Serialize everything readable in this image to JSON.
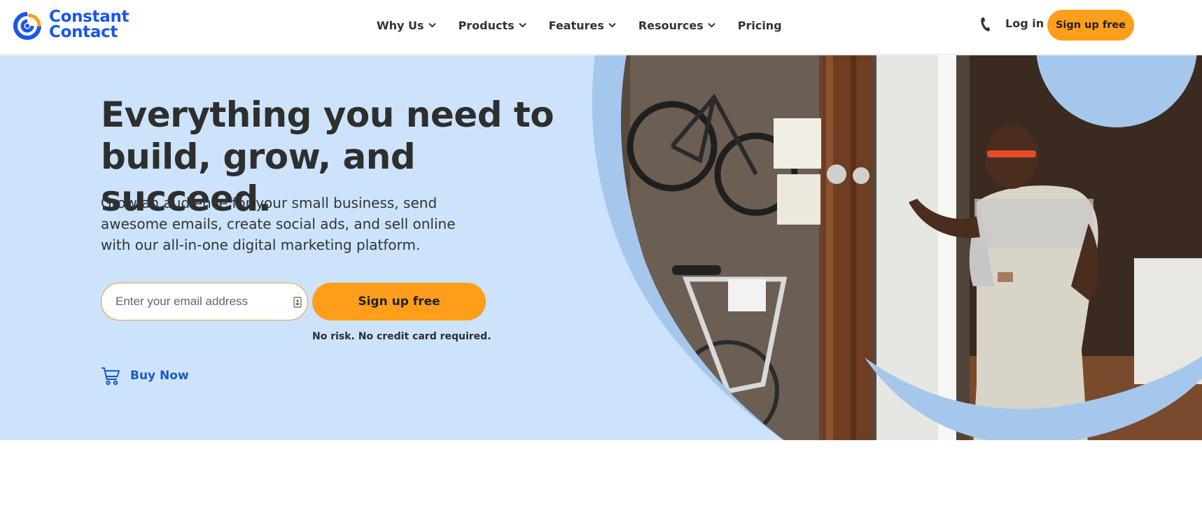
{
  "header": {
    "logo": {
      "line1": "Constant",
      "line2": "Contact",
      "brand_color": "#1856ed",
      "accent_color": "#ff9e1b",
      "icon": "constant-contact-logo"
    },
    "nav": [
      {
        "label": "Why Us",
        "has_dropdown": true
      },
      {
        "label": "Products",
        "has_dropdown": true
      },
      {
        "label": "Features",
        "has_dropdown": true
      },
      {
        "label": "Resources",
        "has_dropdown": true
      },
      {
        "label": "Pricing",
        "has_dropdown": false
      }
    ],
    "phone_icon": "phone-icon",
    "login_label": "Log in",
    "signup_label": "Sign up free"
  },
  "hero": {
    "headline_line1": "Everything you need to",
    "headline_line2": "build, grow, and succeed.",
    "subtext": "Grow an audience for your small business, send awesome emails, create social ads, and sell online with our all-in-one digital marketing platform.",
    "email_placeholder": "Enter your email address",
    "email_value": "",
    "signup_label": "Sign up free",
    "disclaimer": "No risk. No credit card required.",
    "buy_now_label": "Buy Now",
    "buy_now_icon": "cart-icon",
    "background_color": "#cce3fb",
    "cta_color": "#ff9e1b",
    "link_color": "#1c5ac8"
  }
}
